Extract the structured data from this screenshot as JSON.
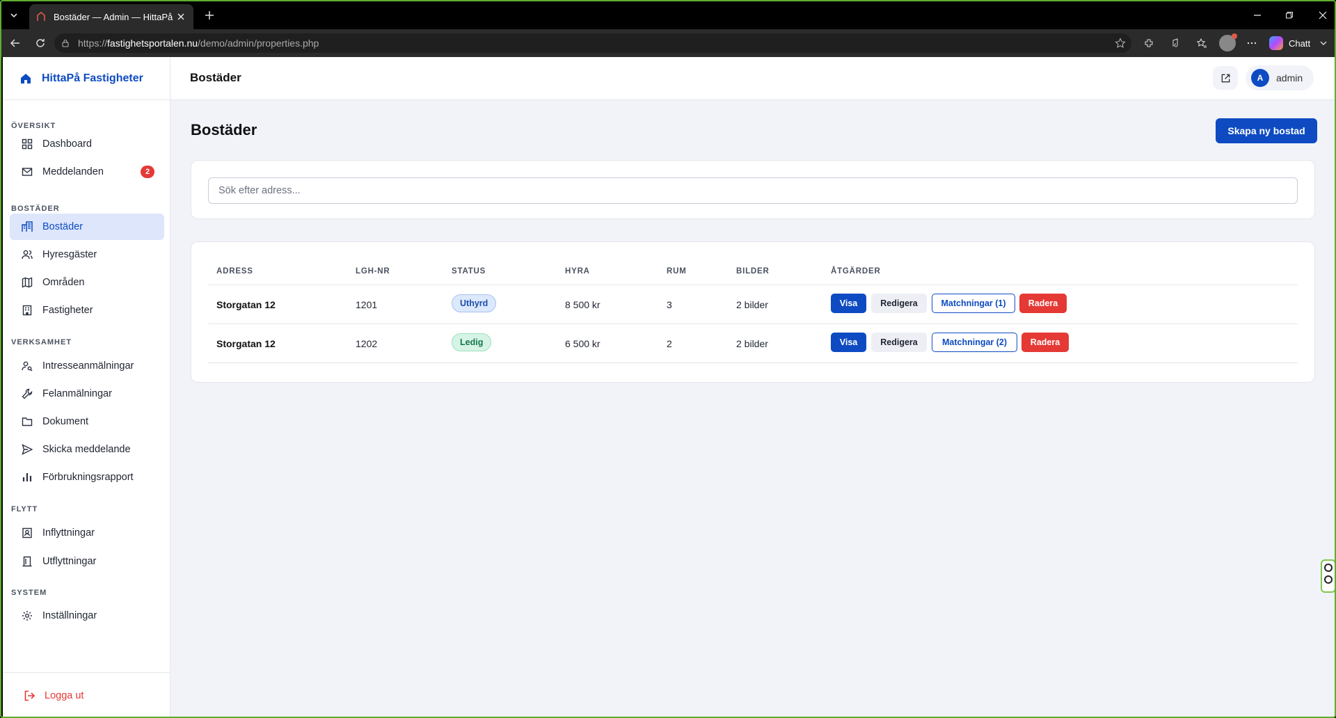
{
  "browser": {
    "tab_title": "Bostäder — Admin — HittaPå Fasti",
    "url_prefix": "https://",
    "url_host": "fastighetsportalen.nu",
    "url_path": "/demo/admin/properties.php",
    "copilot_label": "Chatt"
  },
  "sidebar": {
    "brand": "HittaPå Fastigheter",
    "sections": {
      "oversikt": "ÖVERSIKT",
      "bostader": "BOSTÄDER",
      "verksamhet": "VERKSAMHET",
      "flytt": "FLYTT",
      "system": "SYSTEM"
    },
    "items": {
      "dashboard": "Dashboard",
      "meddelanden": "Meddelanden",
      "meddelanden_count": "2",
      "bostader": "Bostäder",
      "hyresgaster": "Hyresgäster",
      "omraden": "Områden",
      "fastigheter": "Fastigheter",
      "intresse": "Intresseanmälningar",
      "felanmalningar": "Felanmälningar",
      "dokument": "Dokument",
      "skicka": "Skicka meddelande",
      "forbrukning": "Förbrukningsrapport",
      "inflyttningar": "Inflyttningar",
      "utflyttningar": "Utflyttningar",
      "installningar": "Inställningar"
    },
    "logout": "Logga ut"
  },
  "header": {
    "title": "Bostäder",
    "user_initial": "A",
    "user_name": "admin"
  },
  "main": {
    "title": "Bostäder",
    "create_button": "Skapa ny bostad",
    "search_placeholder": "Sök efter adress..."
  },
  "table": {
    "headers": {
      "adress": "ADRESS",
      "lgh": "LGH-NR",
      "status": "STATUS",
      "hyra": "HYRA",
      "rum": "RUM",
      "bilder": "BILDER",
      "atgarder": "ÅTGÄRDER"
    },
    "rows": [
      {
        "adress": "Storgatan 12",
        "lgh": "1201",
        "status": "Uthyrd",
        "hyra": "8 500 kr",
        "rum": "3",
        "bilder": "2 bilder",
        "visa": "Visa",
        "redigera": "Redigera",
        "match": "Matchningar (1)",
        "radera": "Radera"
      },
      {
        "adress": "Storgatan 12",
        "lgh": "1202",
        "status": "Ledig",
        "hyra": "6 500 kr",
        "rum": "2",
        "bilder": "2 bilder",
        "visa": "Visa",
        "redigera": "Redigera",
        "match": "Matchningar (2)",
        "radera": "Radera"
      }
    ]
  },
  "colors": {
    "accent": "#0e4bc2",
    "danger": "#e53935",
    "success": "#16774a"
  }
}
